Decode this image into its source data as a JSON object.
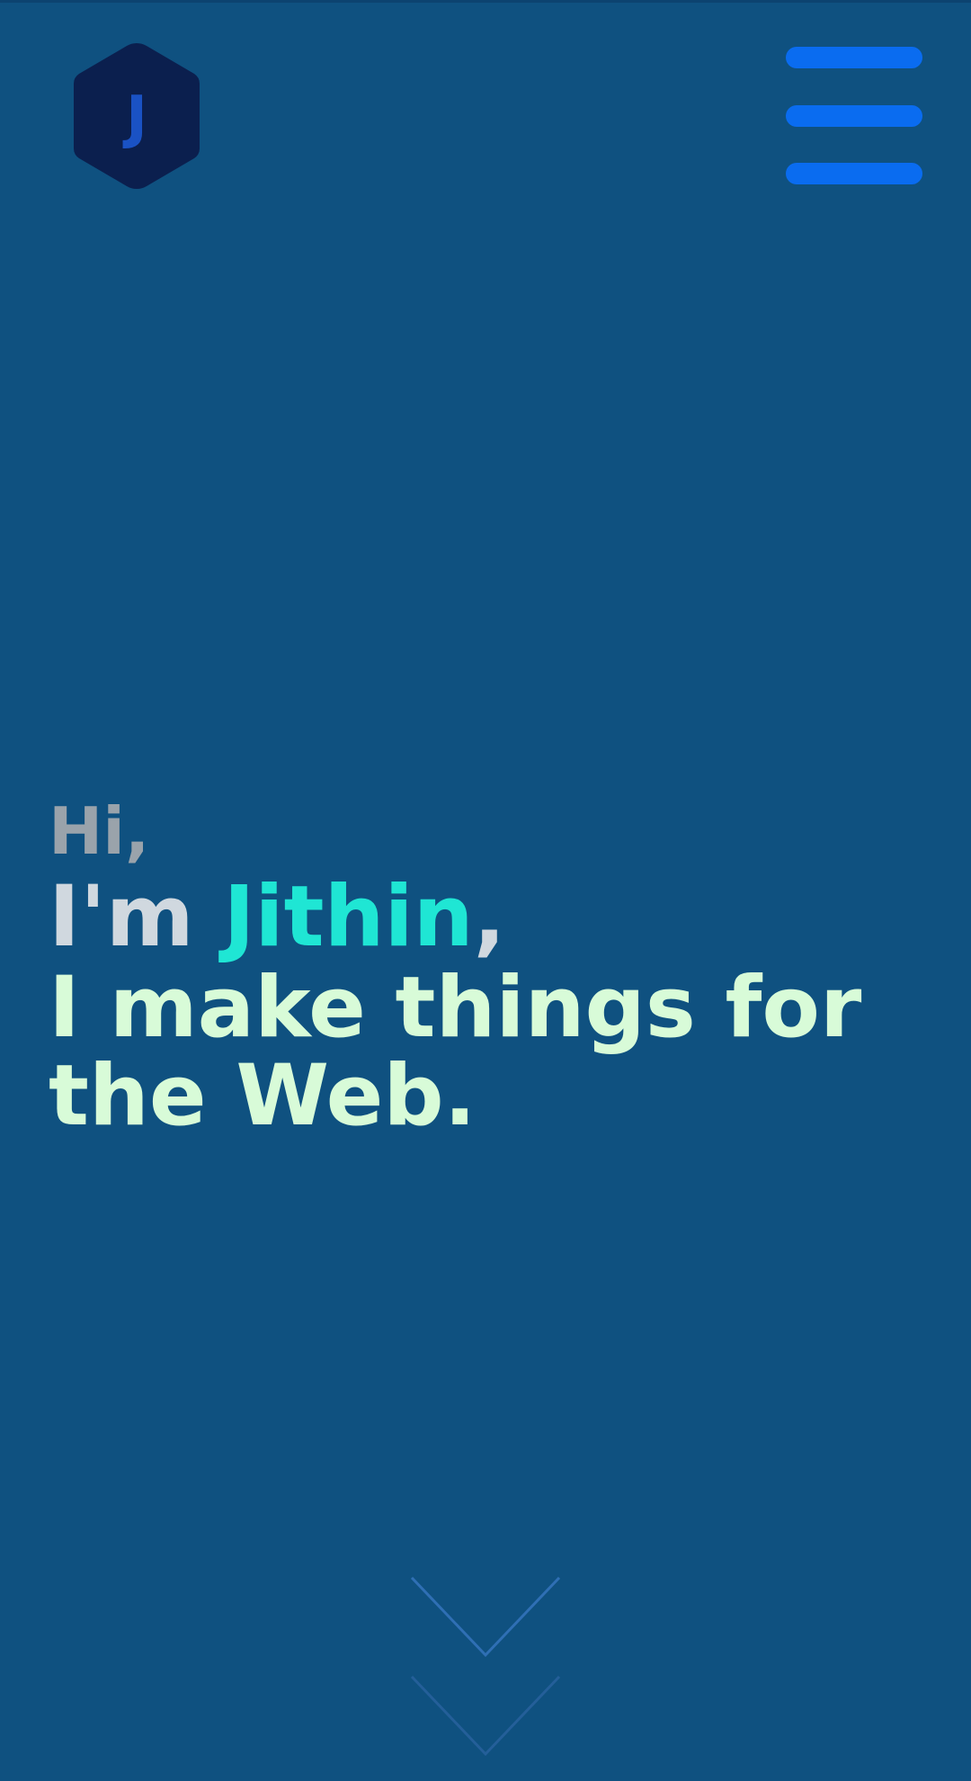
{
  "logo": {
    "letter": "J",
    "hex_color": "#0b1f4e",
    "letter_color": "#1a52c4"
  },
  "header": {
    "menu_icon": "hamburger-menu-icon",
    "menu_color": "#0a6cf0"
  },
  "hero": {
    "greeting": "Hi,",
    "intro_prefix": "I'm ",
    "name": "Jithin",
    "name_suffix": ",",
    "tagline": "I make things for the Web."
  },
  "scroll": {
    "icon": "double-chevron-down-icon"
  },
  "colors": {
    "background": "#0f5180",
    "greeting": "#9aa3ab",
    "intro": "#d0d8df",
    "name_accent": "#1fe6d4",
    "tagline": "#d8fbd8",
    "chevron": "#2f6fb4"
  }
}
